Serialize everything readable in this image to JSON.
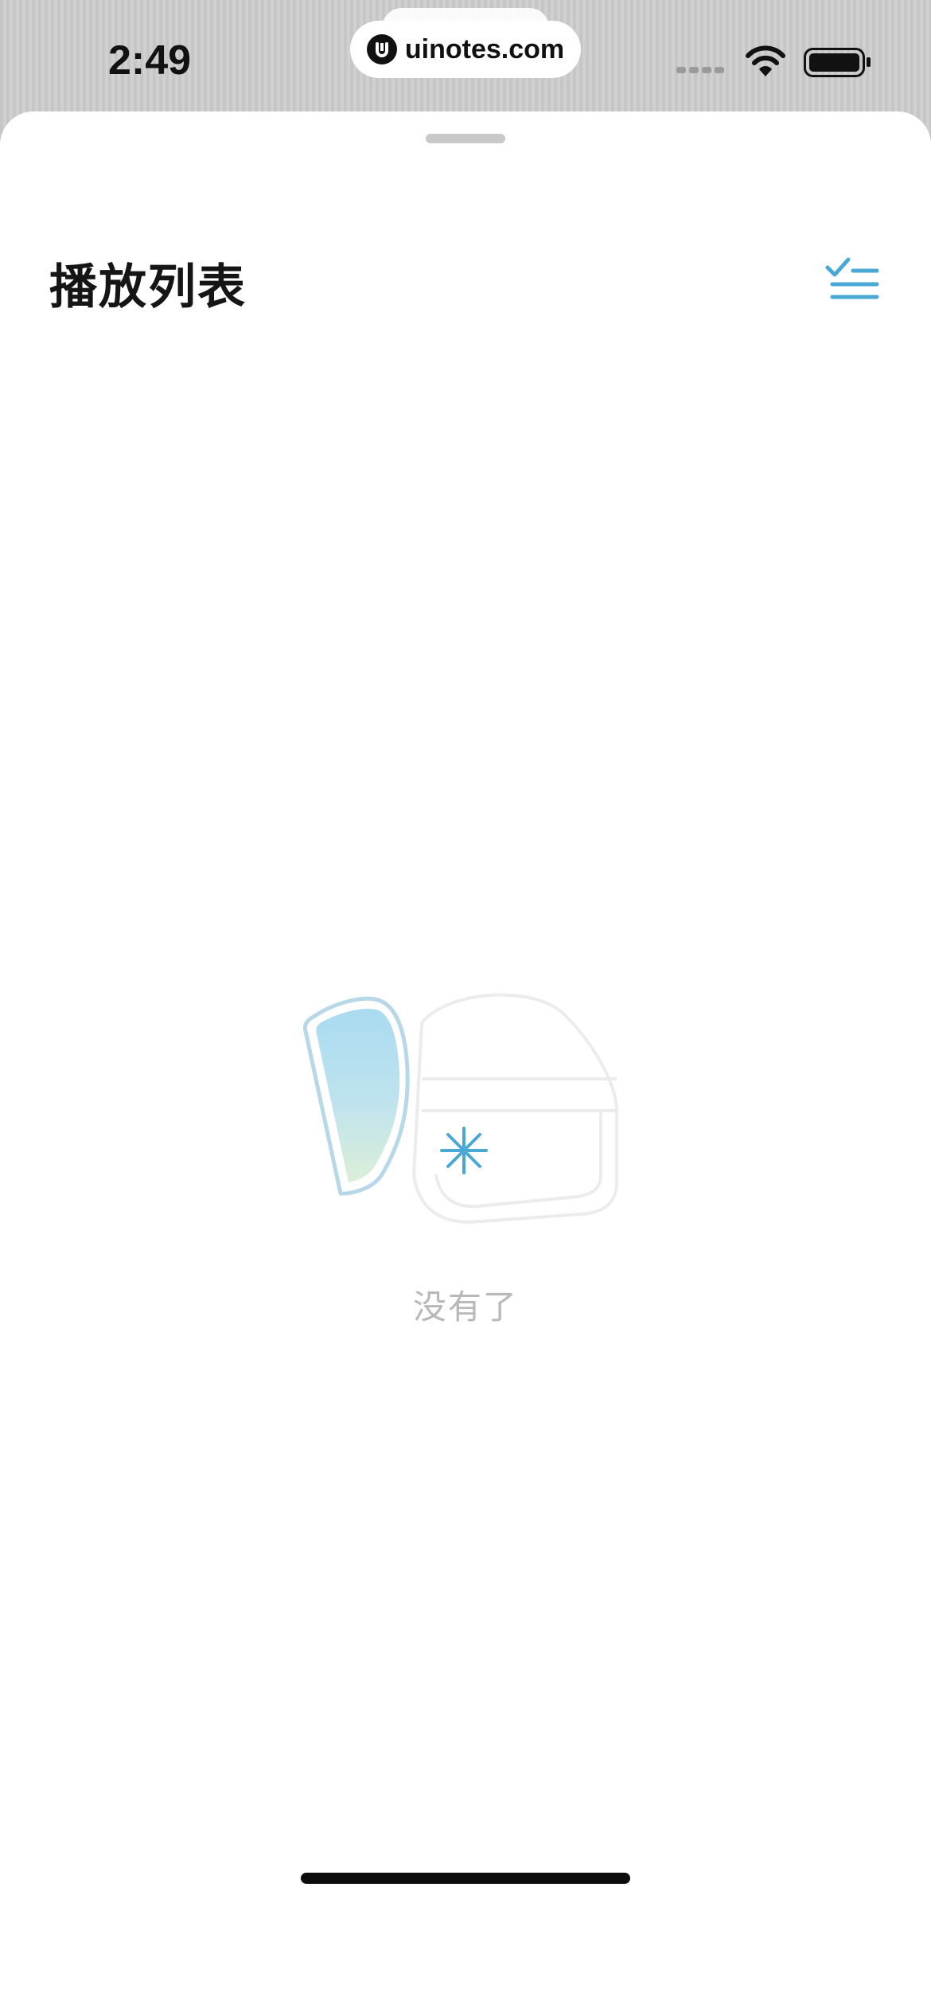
{
  "status_bar": {
    "time": "2:49",
    "url": "uinotes.com",
    "icons": [
      "signal-icon",
      "wifi-icon",
      "battery-icon"
    ]
  },
  "sheet": {
    "title": "播放列表",
    "select_icon": "checklist-icon",
    "empty_text": "没有了",
    "empty_icon": "helmet-empty-illustration"
  },
  "colors": {
    "accent": "#4aa8d4",
    "title": "#151515",
    "empty_text": "#b8b8b8"
  }
}
